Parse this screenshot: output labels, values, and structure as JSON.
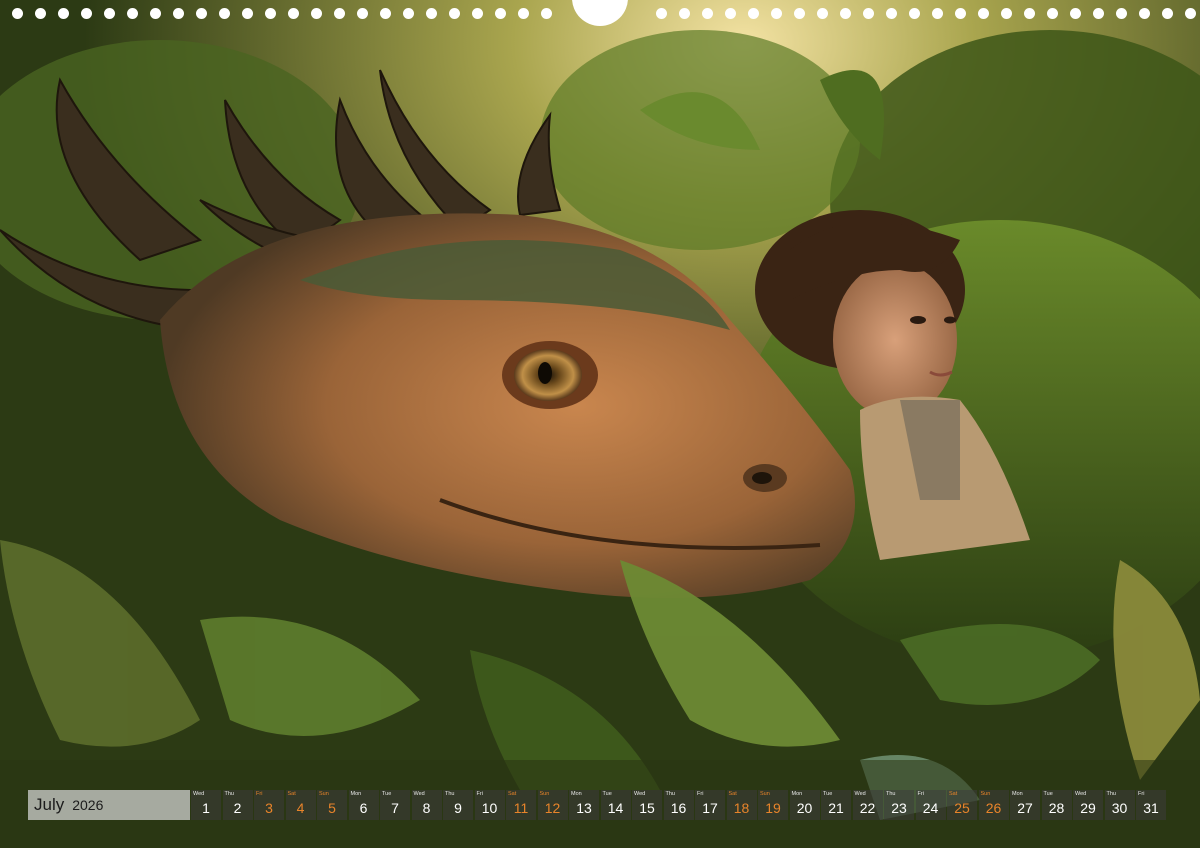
{
  "calendar": {
    "month": "July",
    "year": "2026",
    "days": [
      {
        "dn": "Wed",
        "num": "1",
        "weekend": false
      },
      {
        "dn": "Thu",
        "num": "2",
        "weekend": false
      },
      {
        "dn": "Fri",
        "num": "3",
        "weekend": true
      },
      {
        "dn": "Sat",
        "num": "4",
        "weekend": true
      },
      {
        "dn": "Sun",
        "num": "5",
        "weekend": true
      },
      {
        "dn": "Mon",
        "num": "6",
        "weekend": false
      },
      {
        "dn": "Tue",
        "num": "7",
        "weekend": false
      },
      {
        "dn": "Wed",
        "num": "8",
        "weekend": false
      },
      {
        "dn": "Thu",
        "num": "9",
        "weekend": false
      },
      {
        "dn": "Fri",
        "num": "10",
        "weekend": false
      },
      {
        "dn": "Sat",
        "num": "11",
        "weekend": true
      },
      {
        "dn": "Sun",
        "num": "12",
        "weekend": true
      },
      {
        "dn": "Mon",
        "num": "13",
        "weekend": false
      },
      {
        "dn": "Tue",
        "num": "14",
        "weekend": false
      },
      {
        "dn": "Wed",
        "num": "15",
        "weekend": false
      },
      {
        "dn": "Thu",
        "num": "16",
        "weekend": false
      },
      {
        "dn": "Fri",
        "num": "17",
        "weekend": false
      },
      {
        "dn": "Sat",
        "num": "18",
        "weekend": true
      },
      {
        "dn": "Sun",
        "num": "19",
        "weekend": true
      },
      {
        "dn": "Mon",
        "num": "20",
        "weekend": false
      },
      {
        "dn": "Tue",
        "num": "21",
        "weekend": false
      },
      {
        "dn": "Wed",
        "num": "22",
        "weekend": false
      },
      {
        "dn": "Thu",
        "num": "23",
        "weekend": false
      },
      {
        "dn": "Fri",
        "num": "24",
        "weekend": false
      },
      {
        "dn": "Sat",
        "num": "25",
        "weekend": true
      },
      {
        "dn": "Sun",
        "num": "26",
        "weekend": true
      },
      {
        "dn": "Mon",
        "num": "27",
        "weekend": false
      },
      {
        "dn": "Tue",
        "num": "28",
        "weekend": false
      },
      {
        "dn": "Wed",
        "num": "29",
        "weekend": false
      },
      {
        "dn": "Thu",
        "num": "30",
        "weekend": false
      },
      {
        "dn": "Fri",
        "num": "31",
        "weekend": false
      }
    ]
  },
  "colors": {
    "weekend_accent": "#e8842a",
    "jungle_green": "#3f5a1c",
    "dragon_orange": "#b8632e"
  }
}
